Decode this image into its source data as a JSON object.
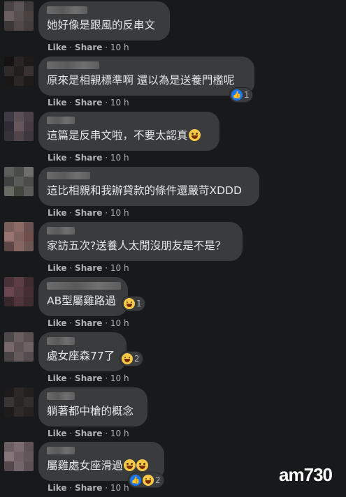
{
  "meta_labels": {
    "like": "Like",
    "share": "Share",
    "sep": "·"
  },
  "comments": [
    {
      "text": "她好像是跟風的反串文",
      "time": "10 h",
      "reaction_count": ""
    },
    {
      "text": "原來是相親標準啊 還以為是送養門檻呢",
      "time": "10 h",
      "reaction_count": "1"
    },
    {
      "text": "這篇是反串文啦，不要太認真",
      "time": "10 h",
      "reaction_count": ""
    },
    {
      "text": "這比相親和我辦貸款的條件還嚴苛XDDD",
      "time": "10 h",
      "reaction_count": ""
    },
    {
      "text": "家訪五次?送養人太閒沒朋友是不是？",
      "time": "10 h",
      "reaction_count": ""
    },
    {
      "text": "AB型屬雞路過",
      "time": "10 h",
      "reaction_count": "1"
    },
    {
      "text": "處女座森77了",
      "time": "10 h",
      "reaction_count": "2"
    },
    {
      "text": "躺著都中槍的概念",
      "time": "10 h",
      "reaction_count": ""
    },
    {
      "text": "屬雞處女座滑過",
      "time": "10 h",
      "reaction_count": "2"
    }
  ],
  "watermark": "am730",
  "colors": {
    "background": "#18191a",
    "bubble": "#3a3b3c",
    "text": "#e4e6eb",
    "meta": "#b0b3b8",
    "like_blue": "#1877f2",
    "haha_yellow": "#f7c948"
  },
  "icons": {
    "like": "like-reaction-icon",
    "haha": "haha-reaction-icon",
    "emoji": "grinning-emoji-icon"
  }
}
